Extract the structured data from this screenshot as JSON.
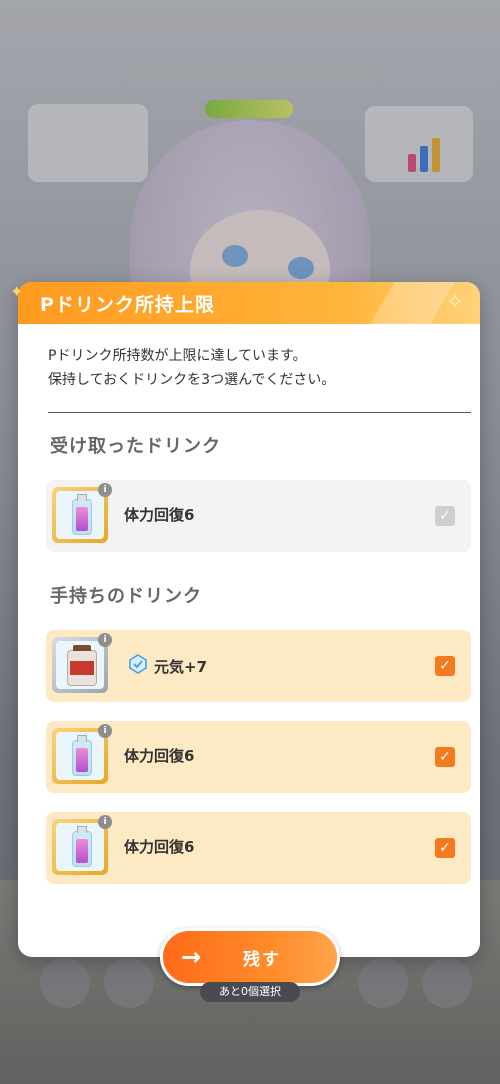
{
  "dialog": {
    "title": "Pドリンク所持上限",
    "message_line1": "Pドリンク所持数が上限に達しています。",
    "message_line2": "保持しておくドリンクを3つ選んでください。",
    "received_section": "受け取ったドリンク",
    "owned_section": "手持ちのドリンク",
    "received_items": [
      {
        "label": "体力回復6",
        "icon": "drink-bottle-icon",
        "checked": true,
        "disabled": true
      }
    ],
    "owned_items": [
      {
        "label": "元気+7",
        "icon": "drink-jar-icon",
        "checked": true
      },
      {
        "label": "体力回復6",
        "icon": "drink-bottle-icon",
        "checked": true
      },
      {
        "label": "体力回復6",
        "icon": "drink-bottle-icon",
        "checked": true
      }
    ]
  },
  "footer": {
    "confirm_label": "残す",
    "remaining_label": "あと0個選択"
  },
  "colors": {
    "accent": "#f37a1f",
    "header": "#ffa42c",
    "selected_row": "#fde9c3"
  }
}
